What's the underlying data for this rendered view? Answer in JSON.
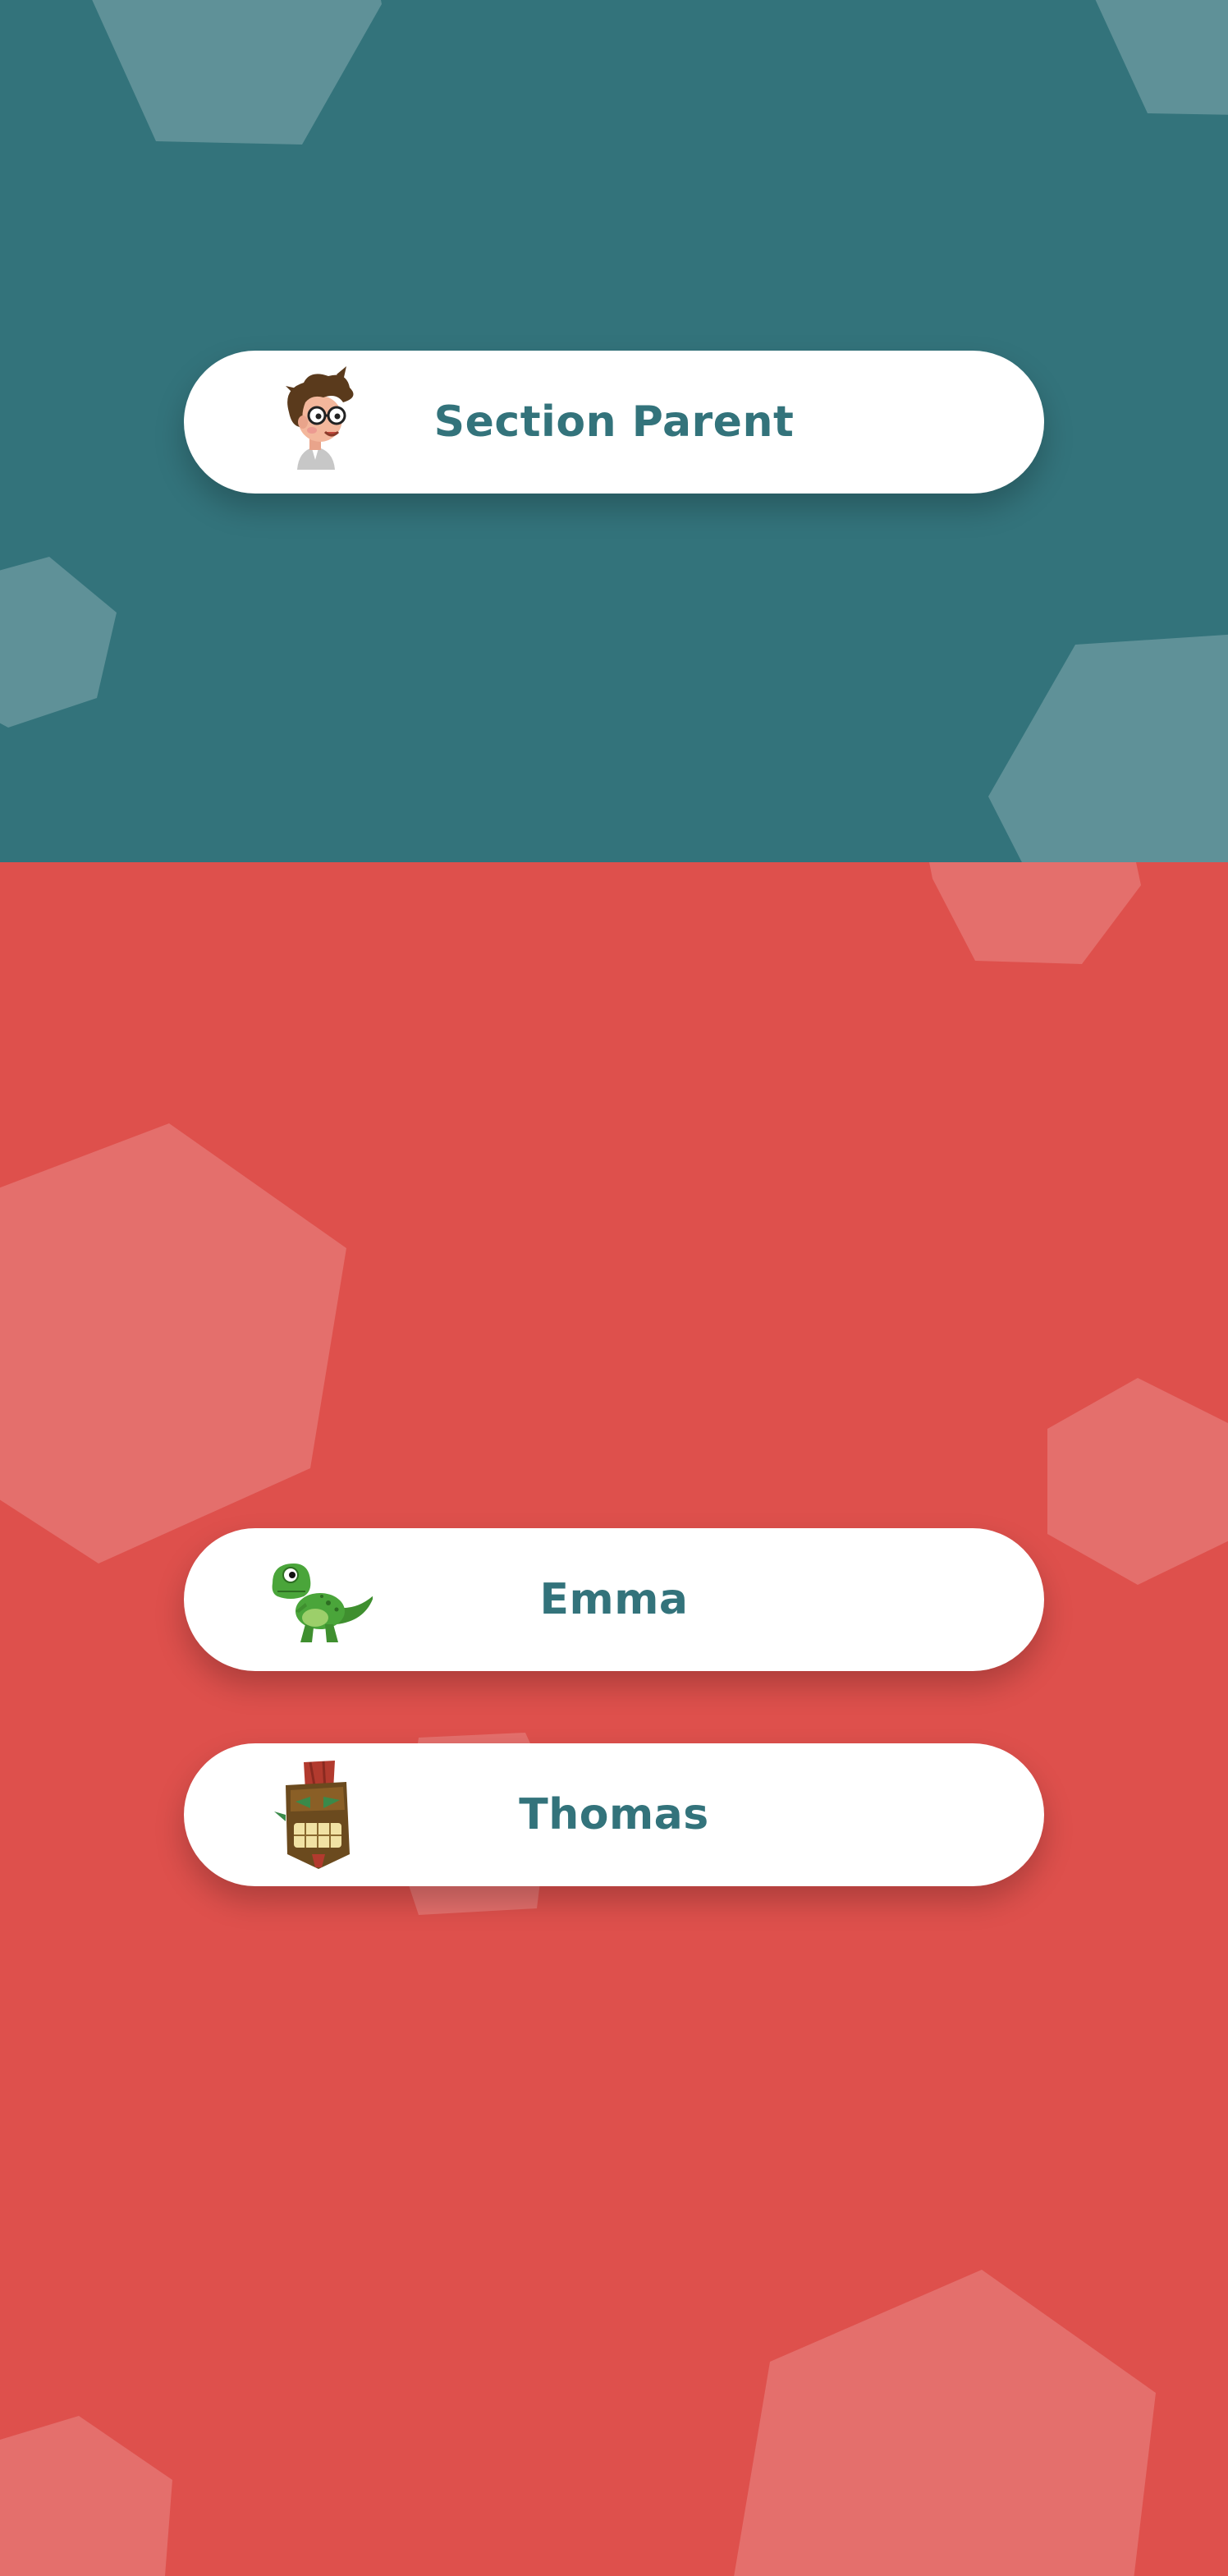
{
  "colors": {
    "parent_background": "#33737B",
    "children_background": "#DE504C",
    "button_background": "#FFFFFF",
    "label_text": "#33737B",
    "shape_on_teal": "rgba(255,255,255,0.22)",
    "shape_on_red": "rgba(255,255,255,0.18)"
  },
  "parent_section": {
    "button": {
      "label": "Section Parent",
      "icon": "parent-avatar-icon"
    }
  },
  "children_section": {
    "profiles": [
      {
        "label": "Emma",
        "icon": "dinosaur-avatar-icon"
      },
      {
        "label": "Thomas",
        "icon": "tiki-mask-avatar-icon"
      }
    ]
  }
}
